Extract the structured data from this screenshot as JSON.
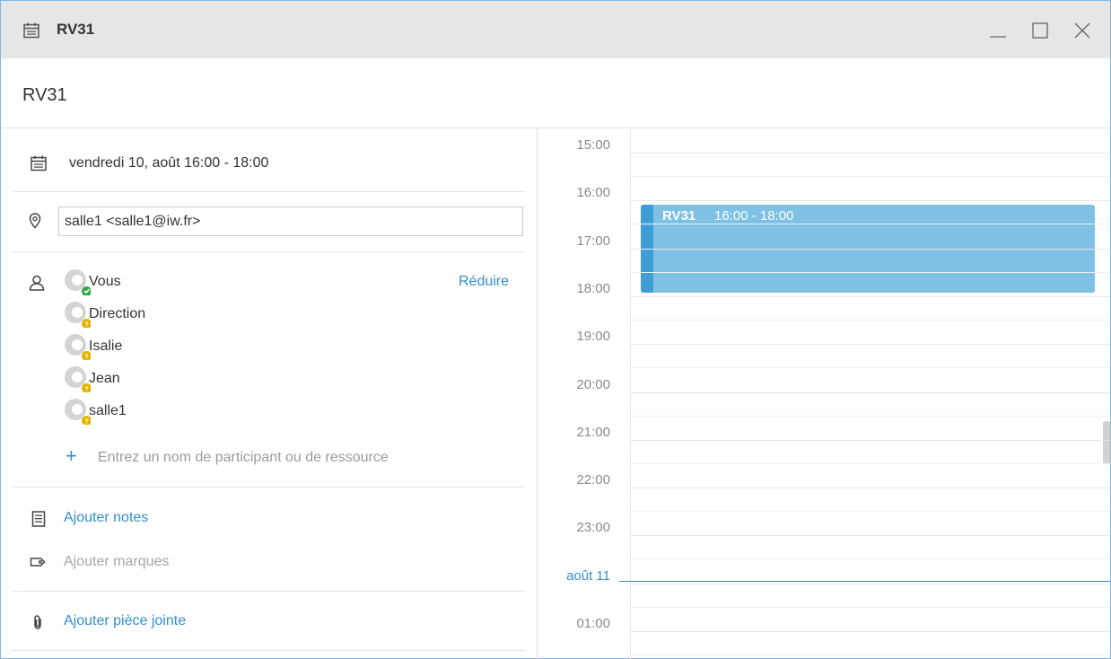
{
  "window": {
    "title": "RV31"
  },
  "event": {
    "title": "RV31",
    "date_line": "vendredi 10, août 16:00 - 18:00",
    "location_value": "salle1 <salle1@iw.fr>"
  },
  "participants": {
    "reduce_label": "Réduire",
    "list": [
      {
        "name": "Vous",
        "status": "accepted",
        "status_color": "#3aa34a"
      },
      {
        "name": "Direction",
        "status": "pending",
        "status_color": "#e0b400"
      },
      {
        "name": "Isalie",
        "status": "pending",
        "status_color": "#e0b400"
      },
      {
        "name": "Jean",
        "status": "pending",
        "status_color": "#e0b400"
      },
      {
        "name": "salle1",
        "status": "pending",
        "status_color": "#e0b400"
      }
    ],
    "add_placeholder": "Entrez un nom de participant ou de ressource"
  },
  "actions": {
    "add_notes": "Ajouter notes",
    "add_tags": "Ajouter marques",
    "add_attachment": "Ajouter pièce jointe"
  },
  "calendar": {
    "hours": [
      "15:00",
      "16:00",
      "17:00",
      "18:00",
      "19:00",
      "20:00",
      "21:00",
      "22:00",
      "23:00",
      "août 11",
      "01:00"
    ],
    "event_title": "RV31",
    "event_time": "16:00 - 18:00",
    "event_color": "#7ec1e4",
    "accent_color": "#2f8fcf"
  },
  "icons": {
    "title": "calendar-icon",
    "date": "calendar-icon",
    "location": "map-pin-icon",
    "participants": "user-icon",
    "notes": "notes-icon",
    "tags": "tag-icon",
    "attachment": "paperclip-icon"
  }
}
